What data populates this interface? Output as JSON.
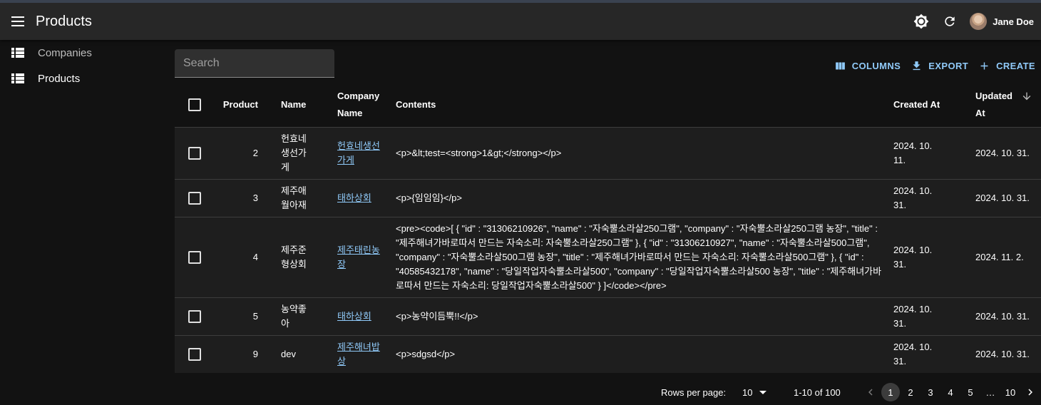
{
  "appbar": {
    "title": "Products",
    "user_name": "Jane Doe"
  },
  "sidebar": {
    "items": [
      {
        "label": "Companies"
      },
      {
        "label": "Products"
      }
    ]
  },
  "search": {
    "placeholder": "Search"
  },
  "toolbar": {
    "columns_label": "COLUMNS",
    "export_label": "EXPORT",
    "create_label": "CREATE"
  },
  "table": {
    "headers": {
      "product": "Product",
      "name": "Name",
      "company_name": "Company Name",
      "contents": "Contents",
      "created_at": "Created At",
      "updated_at": "Updated At"
    },
    "rows": [
      {
        "product": "2",
        "name": "헌효네생선가게",
        "company": "헌효네생선가게",
        "contents": "<p>&lt;test=<strong>1&gt;</strong></p>",
        "created": "2024. 10. 11.",
        "updated": "2024. 10. 31."
      },
      {
        "product": "3",
        "name": "제주애월아재",
        "company": "태하상회",
        "contents": "<p>{임임임}</p>",
        "created": "2024. 10. 31.",
        "updated": "2024. 10. 31."
      },
      {
        "product": "4",
        "name": "제주준형상회",
        "company": "제주태린농장",
        "contents": "<pre><code>[ { \"id\" : \"31306210926\", \"name\" : \"자숙뿔소라살250그램\", \"company\" : \"자숙뿔소라살250그램 농장\", \"title\" : \"제주해녀가바로따서 만드는 자숙소리: 자숙뿔소라살250그램\" }, { \"id\" : \"31306210927\", \"name\" : \"자숙뿔소라살500그램\", \"company\" : \"자숙뿔소라살500그램 농장\", \"title\" : \"제주해녀가바로따서 만드는 자숙소리: 자숙뿔소라살500그램\" }, { \"id\" : \"40585432178\", \"name\" : \"당일작업자숙뿔소라살500\", \"company\" : \"당일작업자숙뿔소라살500 농장\", \"title\" : \"제주해녀가바로따서 만드는 자숙소리: 당일작업자숙뿔소라살500\" } ]</code></pre>",
        "created": "2024. 10. 31.",
        "updated": "2024. 11. 2."
      },
      {
        "product": "5",
        "name": "농약좋아",
        "company": "태하상회",
        "contents": "<p>농약이듬뿍!!</p>",
        "created": "2024. 10. 31.",
        "updated": "2024. 10. 31."
      },
      {
        "product": "9",
        "name": "dev",
        "company": "제주해녀밥상",
        "contents": "<p>sdgsd</p>",
        "created": "2024. 10. 31.",
        "updated": "2024. 10. 31."
      }
    ]
  },
  "pagination": {
    "rows_per_page_label": "Rows per page:",
    "rows_per_page": "10",
    "range": "1-10 of 100",
    "pages": [
      "1",
      "2",
      "3",
      "4",
      "5",
      "…",
      "10"
    ],
    "current_page": "1"
  },
  "colors": {
    "accent": "#90caf9",
    "background": "#121212",
    "appbar": "#272727"
  }
}
